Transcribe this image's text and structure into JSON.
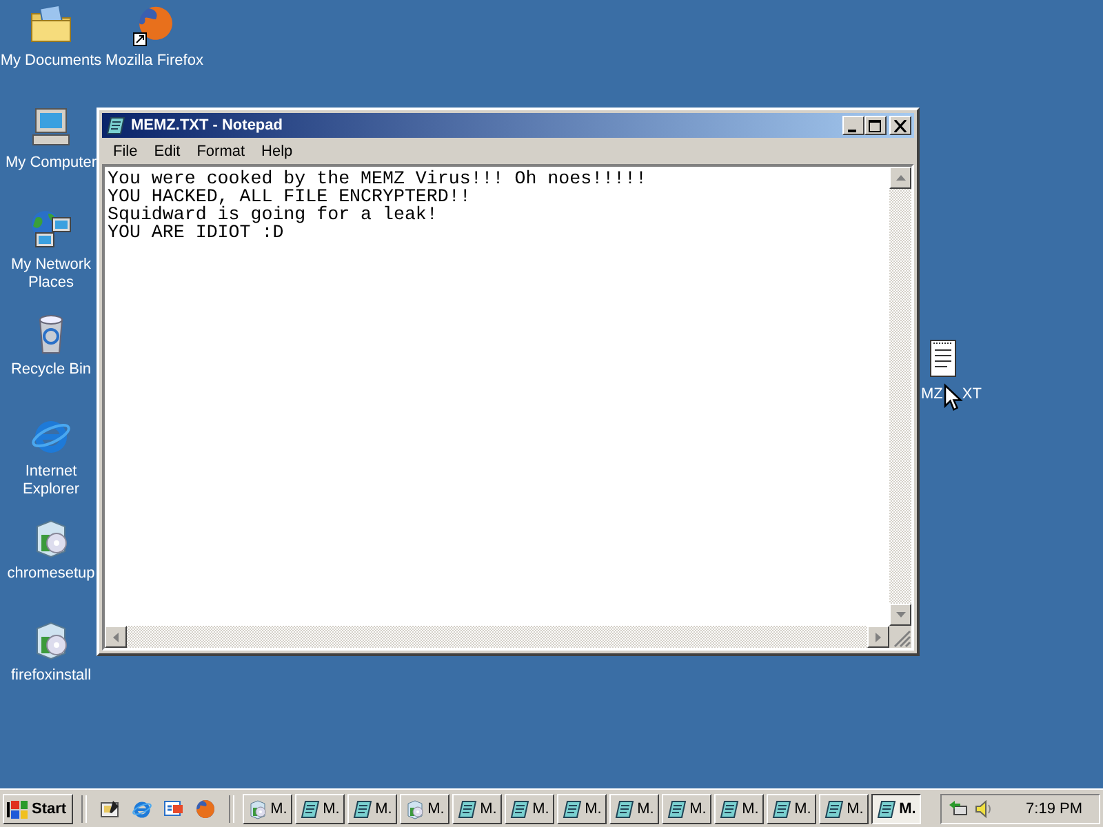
{
  "desktop_icons": [
    {
      "label": "My Documents",
      "kind": "folder"
    },
    {
      "label": "Mozilla Firefox",
      "kind": "firefox"
    },
    {
      "label": "My Computer",
      "kind": "computer"
    },
    {
      "label": "My Network Places",
      "kind": "network"
    },
    {
      "label": "Recycle Bin",
      "kind": "recycle"
    },
    {
      "label": "Internet Explorer",
      "kind": "ie"
    },
    {
      "label": "chromesetup",
      "kind": "setup"
    },
    {
      "label": "firefoxinstall",
      "kind": "setup"
    }
  ],
  "covered_icon": {
    "kind": "notepad",
    "label_parts": [
      "MZ",
      "XT"
    ]
  },
  "window": {
    "title": "MEMZ.TXT - Notepad",
    "menu": [
      "File",
      "Edit",
      "Format",
      "Help"
    ],
    "lines": [
      "You were cooked by the MEMZ Virus!!! Oh noes!!!!!",
      "YOU HACKED, ALL FILE ENCRYPTERD!!",
      "Squidward is going for a leak!",
      "YOU ARE IDIOT :D"
    ]
  },
  "taskbar": {
    "start": "Start",
    "quick_launch": [
      {
        "kind": "desktop"
      },
      {
        "kind": "ie"
      },
      {
        "kind": "channels"
      },
      {
        "kind": "firefoxsmall"
      }
    ],
    "tasks": [
      {
        "label": "M.",
        "kind": "setup",
        "selected": false
      },
      {
        "label": "M.",
        "kind": "notepadapp",
        "selected": false
      },
      {
        "label": "M.",
        "kind": "notepadapp",
        "selected": false
      },
      {
        "label": "M.",
        "kind": "setup",
        "selected": false
      },
      {
        "label": "M.",
        "kind": "notepadapp",
        "selected": false
      },
      {
        "label": "M.",
        "kind": "notepadapp",
        "selected": false
      },
      {
        "label": "M.",
        "kind": "notepadapp",
        "selected": false
      },
      {
        "label": "M.",
        "kind": "notepadapp",
        "selected": false
      },
      {
        "label": "M.",
        "kind": "notepadapp",
        "selected": false
      },
      {
        "label": "M.",
        "kind": "notepadapp",
        "selected": false
      },
      {
        "label": "M.",
        "kind": "notepadapp",
        "selected": false
      },
      {
        "label": "M.",
        "kind": "notepadapp",
        "selected": false
      },
      {
        "label": "M.",
        "kind": "notepadapp",
        "selected": true
      }
    ],
    "tray": [
      {
        "kind": "traynet"
      },
      {
        "kind": "volume"
      }
    ],
    "clock": "7:19 PM"
  }
}
